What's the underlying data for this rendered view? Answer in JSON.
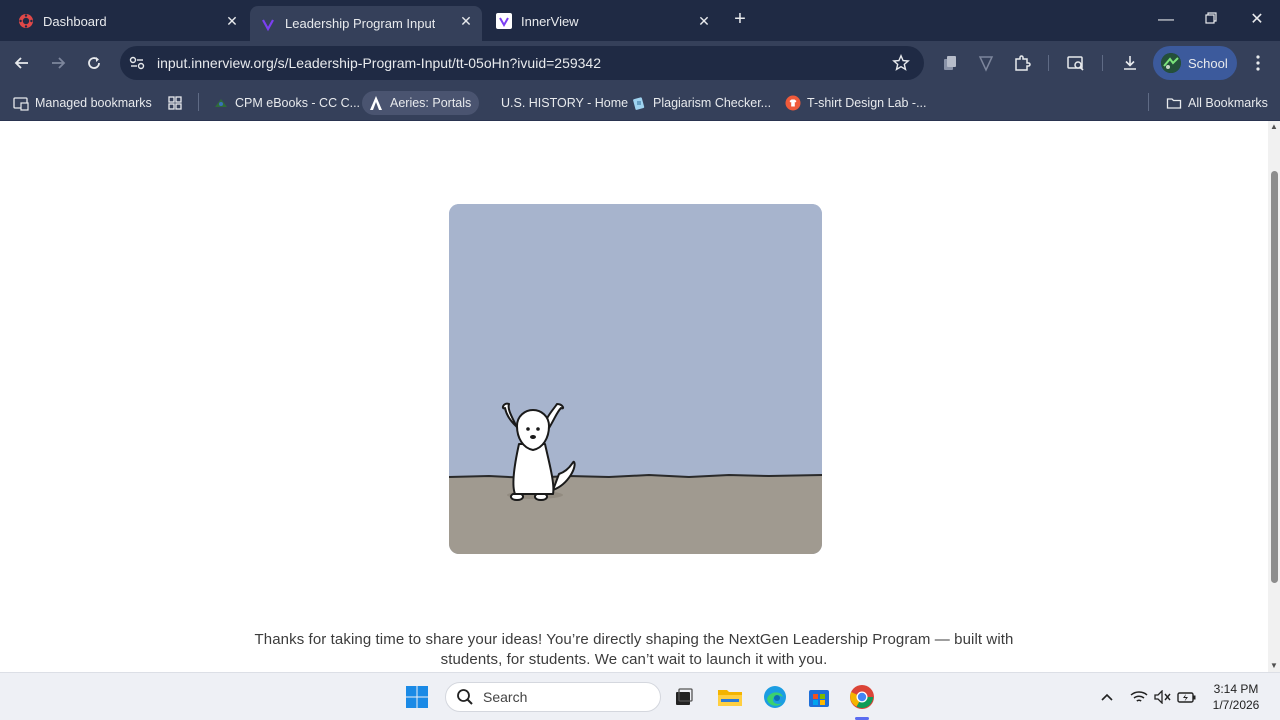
{
  "tabs": [
    {
      "label": "Dashboard",
      "active": false
    },
    {
      "label": "Leadership Program Input",
      "active": true
    },
    {
      "label": "InnerView",
      "active": false
    }
  ],
  "toolbar": {
    "url": "input.innerview.org/s/Leadership-Program-Input/tt-05oHn?ivuid=259342",
    "profile_label": "School"
  },
  "bookmarks": {
    "managed": "Managed bookmarks",
    "items": [
      {
        "label": "CPM eBooks - CC C..."
      },
      {
        "label": "Aeries: Portals"
      },
      {
        "label": "U.S. HISTORY - Home"
      },
      {
        "label": "Plagiarism Checker..."
      },
      {
        "label": "T-shirt Design Lab -..."
      }
    ],
    "all": "All Bookmarks"
  },
  "page": {
    "thanks_line1": "Thanks for taking  time to share your ideas! You’re directly shaping the NextGen Leadership Program — built with",
    "thanks_line2": "students, for students. We can’t wait to launch it with you."
  },
  "taskbar": {
    "search_placeholder": "Search",
    "time": "3:14 PM",
    "date": "1/7/2026"
  },
  "colors": {
    "tab_strip": "#1f2a44",
    "toolbar": "#35405a",
    "scene_sky": "#a7b4cd",
    "scene_ground": "#a09a90"
  }
}
